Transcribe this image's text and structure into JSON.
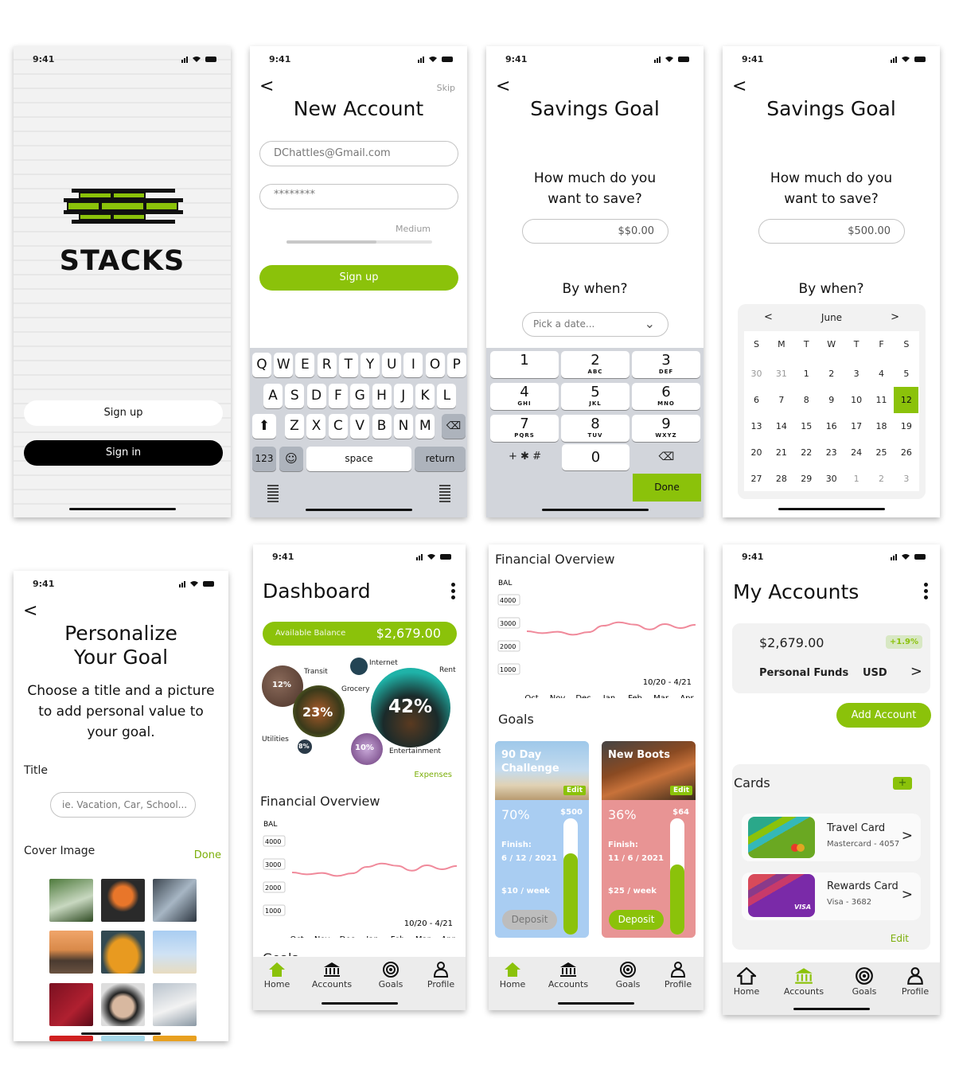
{
  "status_time": "9:41",
  "welcome": {
    "brand": "STACKS",
    "signup": "Sign up",
    "signin": "Sign in"
  },
  "new_account": {
    "title": "New Account",
    "skip": "Skip",
    "email": "DChattles@Gmail.com",
    "password": "********",
    "strength": "Medium",
    "strength_level": 0.62,
    "signup": "Sign up"
  },
  "keyboard": {
    "row1": [
      "Q",
      "W",
      "E",
      "R",
      "T",
      "Y",
      "U",
      "I",
      "O",
      "P"
    ],
    "row2": [
      "A",
      "S",
      "D",
      "F",
      "G",
      "H",
      "J",
      "K",
      "L"
    ],
    "row3": [
      "Z",
      "X",
      "C",
      "V",
      "B",
      "N",
      "M"
    ],
    "num_key": "123",
    "space": "space",
    "return": "return"
  },
  "savings1": {
    "title": "Savings Goal",
    "question_line1": "How much do you",
    "question_line2": "want to save?",
    "amount": "$$0.00",
    "by_when": "By when?",
    "date_placeholder": "Pick a date...",
    "done": "Done"
  },
  "numpad": [
    {
      "n": "1",
      "l": ""
    },
    {
      "n": "2",
      "l": "ABC"
    },
    {
      "n": "3",
      "l": "DEF"
    },
    {
      "n": "4",
      "l": "GHI"
    },
    {
      "n": "5",
      "l": "JKL"
    },
    {
      "n": "6",
      "l": "MNO"
    },
    {
      "n": "7",
      "l": "PQRS"
    },
    {
      "n": "8",
      "l": "TUV"
    },
    {
      "n": "9",
      "l": "WXYZ"
    }
  ],
  "numpad_extra": {
    "symbols": "+ ✱ #",
    "zero": "0"
  },
  "savings2": {
    "title": "Savings Goal",
    "question_line1": "How much do you",
    "question_line2": "want to save?",
    "amount": "$500.00",
    "by_when": "By when?",
    "month": "June",
    "prev": "<",
    "next": ">"
  },
  "calendar": {
    "weekdays": [
      "S",
      "M",
      "T",
      "W",
      "T",
      "F",
      "S"
    ],
    "weeks": [
      [
        "30",
        "31",
        "1",
        "2",
        "3",
        "4",
        "5"
      ],
      [
        "6",
        "7",
        "8",
        "9",
        "10",
        "11",
        "12"
      ],
      [
        "13",
        "14",
        "15",
        "16",
        "17",
        "18",
        "19"
      ],
      [
        "20",
        "21",
        "22",
        "23",
        "24",
        "25",
        "26"
      ],
      [
        "27",
        "28",
        "29",
        "30",
        "1",
        "2",
        "3"
      ]
    ],
    "muted": [
      "0-0",
      "0-1",
      "4-4",
      "4-5",
      "4-6"
    ],
    "selected": "1-6"
  },
  "personalize": {
    "title_line1": "Personalize",
    "title_line2": "Your Goal",
    "desc_line1": "Choose a title and a picture",
    "desc_line2": "to add personal value to",
    "desc_line3": "your goal.",
    "title_label": "Title",
    "title_placeholder": "ie. Vacation, Car, School...",
    "cover_label": "Cover Image",
    "done": "Done"
  },
  "dashboard": {
    "title": "Dashboard",
    "balance_label": "Available Balance",
    "balance": "$2,679.00",
    "expenses_link": "Expenses",
    "overview_title": "Financial Overview",
    "bubbles": [
      {
        "label": "Transit",
        "pct": "12%"
      },
      {
        "label": "Internet",
        "pct": ""
      },
      {
        "label": "Rent",
        "pct": "42%"
      },
      {
        "label": "Grocery",
        "pct": "23%"
      },
      {
        "label": "Utilities",
        "pct": "8%"
      },
      {
        "label": "Entertainment",
        "pct": "10%"
      }
    ],
    "goals_partial": "Goals"
  },
  "overview": {
    "title": "Financial Overview",
    "goals_title": "Goals"
  },
  "chart_data": {
    "type": "line",
    "ylabel": "BAL",
    "y_ticks": [
      "4000",
      "3000",
      "2000",
      "1000"
    ],
    "x": [
      "Oct",
      "Nov",
      "Dec",
      "Jan",
      "Feb",
      "Mar",
      "Apr"
    ],
    "range_label": "10/20 - 4/21",
    "values": [
      2620,
      2540,
      2600,
      2470,
      2580,
      2860,
      3010,
      2910,
      2700,
      2930,
      2760,
      2900
    ],
    "ylim": [
      1000,
      4000
    ],
    "color": "#f08a9b"
  },
  "goals": [
    {
      "title_line1": "90 Day",
      "title_line2": "Challenge",
      "edit": "Edit",
      "pct": "70%",
      "amount": "$500",
      "finish_label": "Finish:",
      "finish": "6 / 12 / 2021",
      "rate": "$10 / week",
      "deposit": "Deposit",
      "progress": 0.7,
      "color": "#a9cdf2"
    },
    {
      "title_line1": "New Boots",
      "title_line2": "",
      "edit": "Edit",
      "pct": "36%",
      "amount": "$64",
      "finish_label": "Finish:",
      "finish": "11 / 6 / 2021",
      "rate": "$25 / week",
      "deposit": "Deposit",
      "progress": 0.6,
      "color": "#e89494"
    }
  ],
  "accounts": {
    "title": "My Accounts",
    "balance": "$2,679.00",
    "change": "+1.9%",
    "name": "Personal Funds",
    "currency": "USD",
    "add": "Add Account",
    "cards_title": "Cards",
    "edit": "Edit",
    "cards": [
      {
        "name": "Travel Card",
        "sub": "Mastercard - 4057"
      },
      {
        "name": "Rewards Card",
        "sub": "Visa - 3682",
        "brand": "VISA"
      }
    ]
  },
  "nav": {
    "home": "Home",
    "accounts": "Accounts",
    "goals": "Goals",
    "profile": "Profile"
  },
  "colors": {
    "accent": "#8bc20a",
    "line": "#f08a9b"
  }
}
